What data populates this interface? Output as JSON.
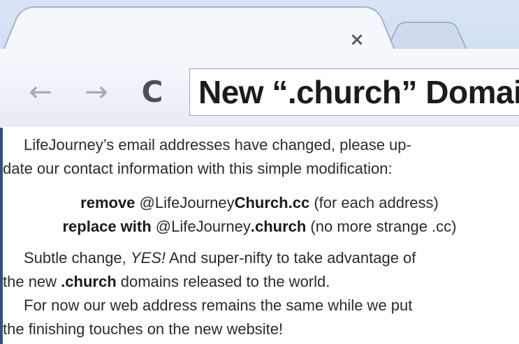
{
  "browser": {
    "tab_close_glyph": "×",
    "back_glyph": "←",
    "forward_glyph": "→",
    "reload_glyph": "C",
    "omnibox_text": "New “.church” Domain"
  },
  "content": {
    "p1_line1": "LifeJourney’s email addresses have changed, please up-",
    "p1_line2": "date our contact information with this simple modification:",
    "remove_label": "remove",
    "remove_prefix": " @LifeJourney",
    "remove_domain": "Church.cc",
    "remove_note": " (for each address)",
    "replace_label": "replace with",
    "replace_prefix": " @LifeJourney",
    "replace_domain": ".church",
    "replace_note": " (no more strange .cc)",
    "p2_a": "Subtle change, ",
    "p2_yes": "YES!",
    "p2_b": " And super-nifty to take advantage of",
    "p2_c": "the new ",
    "p2_church": ".church",
    "p2_d": " domains released to the world.",
    "p3_line1": "For now our web address remains the same while we put",
    "p3_line2": "the finishing touches on the new website!"
  }
}
